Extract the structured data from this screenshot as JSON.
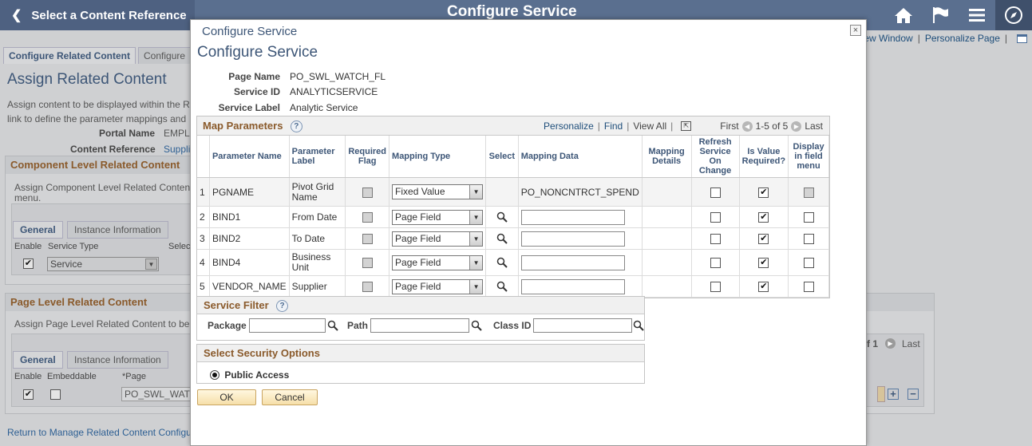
{
  "topbar": {
    "back_label": "Select a Content Reference",
    "page_title": "Configure Service",
    "icons": [
      "home-icon",
      "flag-icon",
      "menu-icon",
      "navbar-compass-icon"
    ]
  },
  "background": {
    "links": {
      "new_window": "New Window",
      "personalize_page": "Personalize Page"
    },
    "tabs": [
      "Configure Related Content",
      "Configure"
    ],
    "heading": "Assign Related Content",
    "intro_line1": "Assign content to be displayed within the R",
    "intro_line2": "link to define the parameter mappings and",
    "portal_name_label": "Portal Name",
    "portal_name_value": "EMPL",
    "content_ref_label": "Content Reference",
    "content_ref_value": "Suppli",
    "component_section": {
      "title": "Component Level Related Content",
      "text1": "Assign Component Level Related Conten",
      "text2": "menu.",
      "tab_general": "General",
      "tab_instance": "Instance Information",
      "col_enable": "Enable",
      "col_service_type": "Service Type",
      "col_select": "Selec",
      "service_type_value": "Service"
    },
    "page_section": {
      "title": "Page Level Related Content",
      "text1": "Assign Page Level Related Content to be",
      "tab_general": "General",
      "tab_instance": "Instance Information",
      "col_enable": "Enable",
      "col_embeddable": "Embeddable",
      "col_page": "*Page",
      "page_value": "PO_SWL_WAT",
      "nav_of": "f 1",
      "nav_last": "Last"
    },
    "footer_link": "Return to Manage Related Content Configu"
  },
  "modal": {
    "window_title": "Configure Service",
    "heading": "Configure Service",
    "page_name_label": "Page Name",
    "page_name_value": "PO_SWL_WATCH_FL",
    "service_id_label": "Service ID",
    "service_id_value": "ANALYTICSERVICE",
    "service_label_label": "Service Label",
    "service_label_value": "Analytic Service",
    "map_params": {
      "title": "Map Parameters",
      "personalize": "Personalize",
      "find": "Find",
      "view_all": "View All",
      "first": "First",
      "range": "1-5 of 5",
      "last": "Last",
      "columns": {
        "param_name": "Parameter Name",
        "param_label": "Parameter Label",
        "required_flag": "Required Flag",
        "mapping_type": "Mapping Type",
        "select": "Select",
        "mapping_data": "Mapping Data",
        "mapping_details": "Mapping Details",
        "refresh": "Refresh Service On Change",
        "is_value_required": "Is Value Required?",
        "display_in_menu": "Display in field menu"
      },
      "rows": [
        {
          "num": "1",
          "name": "PGNAME",
          "label": "Pivot Grid Name",
          "mapping_type": "Fixed Value",
          "mapping_data": "PO_NONCNTRCT_SPEND",
          "value_required": "✔"
        },
        {
          "num": "2",
          "name": "BIND1",
          "label": "From Date",
          "mapping_type": "Page Field",
          "mapping_data": "",
          "value_required": "✔"
        },
        {
          "num": "3",
          "name": "BIND2",
          "label": "To Date",
          "mapping_type": "Page Field",
          "mapping_data": "",
          "value_required": "✔"
        },
        {
          "num": "4",
          "name": "BIND4",
          "label": "Business Unit",
          "mapping_type": "Page Field",
          "mapping_data": "",
          "value_required": "✔"
        },
        {
          "num": "5",
          "name": "VENDOR_NAME",
          "label": "Supplier",
          "mapping_type": "Page Field",
          "mapping_data": "",
          "value_required": "✔"
        }
      ]
    },
    "service_filter": {
      "title": "Service Filter",
      "package_label": "Package",
      "path_label": "Path",
      "class_id_label": "Class ID"
    },
    "security": {
      "title": "Select Security Options",
      "public_access": "Public Access"
    },
    "ok_label": "OK",
    "cancel_label": "Cancel",
    "close_glyph": "×"
  }
}
